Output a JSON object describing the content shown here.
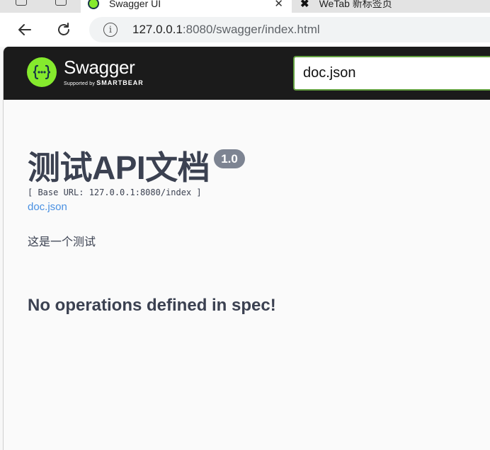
{
  "browser": {
    "tabs": [
      {
        "title": "Swagger UI",
        "favicon": "swagger-favicon",
        "active": true
      },
      {
        "title": "WeTab 新标签页",
        "favicon": "wetab-favicon",
        "active": false
      }
    ],
    "url": {
      "host": "127.0.0.1",
      "rest": ":8080/swagger/index.html"
    },
    "info_icon": "i"
  },
  "topbar": {
    "logo_name": "Swagger",
    "logo_supported_by": "Supported by",
    "logo_smartbear": "SMARTBEAR",
    "spec_input_value": "doc.json",
    "accent_color": "#85ea2d",
    "bar_color": "#1b1b1b"
  },
  "info": {
    "title": "测试API文档",
    "version": "1.0",
    "base_url": "[ Base URL: 127.0.0.1:8080/index ]",
    "spec_link": "doc.json",
    "description": "这是一个测试"
  },
  "operations": {
    "empty_message": "No operations defined in spec!"
  }
}
